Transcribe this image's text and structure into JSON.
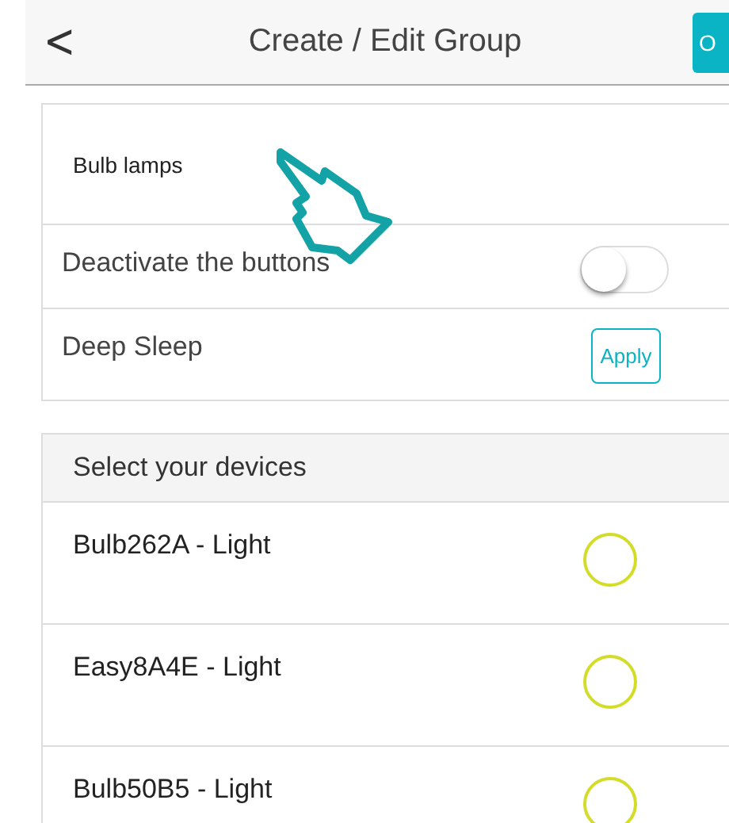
{
  "header": {
    "back": "<",
    "title": "Create / Edit Group",
    "ok_button": "O"
  },
  "settings": {
    "group_name": "Bulb lamps",
    "rows": [
      {
        "kind": "toggle",
        "label": "Deactivate the buttons",
        "on": false
      },
      {
        "kind": "button",
        "label": "Deep Sleep",
        "button": "Apply"
      }
    ]
  },
  "devices": {
    "heading": "Select your devices",
    "items": [
      {
        "name": "Bulb262A - Light",
        "selected": false
      },
      {
        "name": "Easy8A4E - Light",
        "selected": false
      },
      {
        "name": "Bulb50B5 - Light",
        "selected": false
      }
    ]
  }
}
